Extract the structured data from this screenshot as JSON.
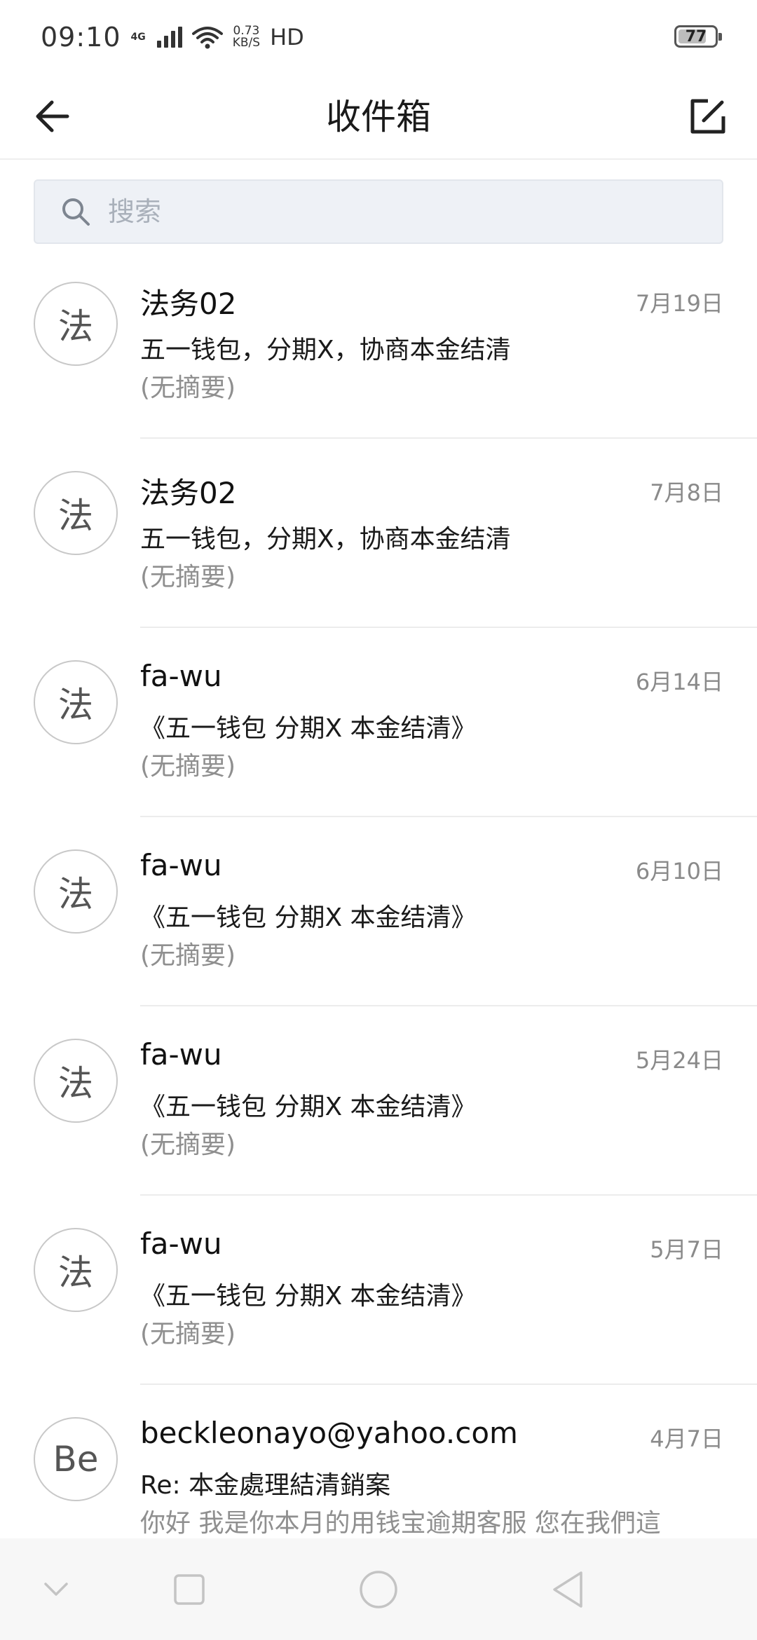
{
  "status_bar": {
    "time": "09:10",
    "network_type": "4G",
    "net_speed_value": "0.73",
    "net_speed_unit": "KB/S",
    "hd_label": "HD",
    "battery_percent": "77",
    "battery_level": 0.77
  },
  "header": {
    "title": "收件箱",
    "back_icon": "arrow-left-icon",
    "compose_icon": "compose-icon"
  },
  "search": {
    "placeholder": "搜索",
    "value": ""
  },
  "mails": [
    {
      "avatar": "法",
      "sender": "法务02",
      "date": "7月19日",
      "subject": "五一钱包，分期X，协商本金结清",
      "summary": "(无摘要)"
    },
    {
      "avatar": "法",
      "sender": "法务02",
      "date": "7月8日",
      "subject": "五一钱包，分期X，协商本金结清",
      "summary": "(无摘要)"
    },
    {
      "avatar": "法",
      "sender": "fa-wu",
      "date": "6月14日",
      "subject": "《五一钱包 分期X  本金结清》",
      "summary": "(无摘要)"
    },
    {
      "avatar": "法",
      "sender": "fa-wu",
      "date": "6月10日",
      "subject": "《五一钱包 分期X  本金结清》",
      "summary": "(无摘要)"
    },
    {
      "avatar": "法",
      "sender": "fa-wu",
      "date": "5月24日",
      "subject": "《五一钱包 分期X  本金结清》",
      "summary": "(无摘要)"
    },
    {
      "avatar": "法",
      "sender": "fa-wu",
      "date": "5月7日",
      "subject": "《五一钱包 分期X  本金结清》",
      "summary": "(无摘要)"
    },
    {
      "avatar": "Be",
      "sender": "beckleonayo@yahoo.com",
      "date": "4月7日",
      "subject": "Re: 本金處理結清銷案",
      "summary": "你好 我是你本月的用钱宝逾期客服 您在我們這"
    }
  ],
  "nav_bar": {
    "icons": [
      "chevron-down-icon",
      "square-icon",
      "circle-icon",
      "triangle-back-icon"
    ]
  }
}
